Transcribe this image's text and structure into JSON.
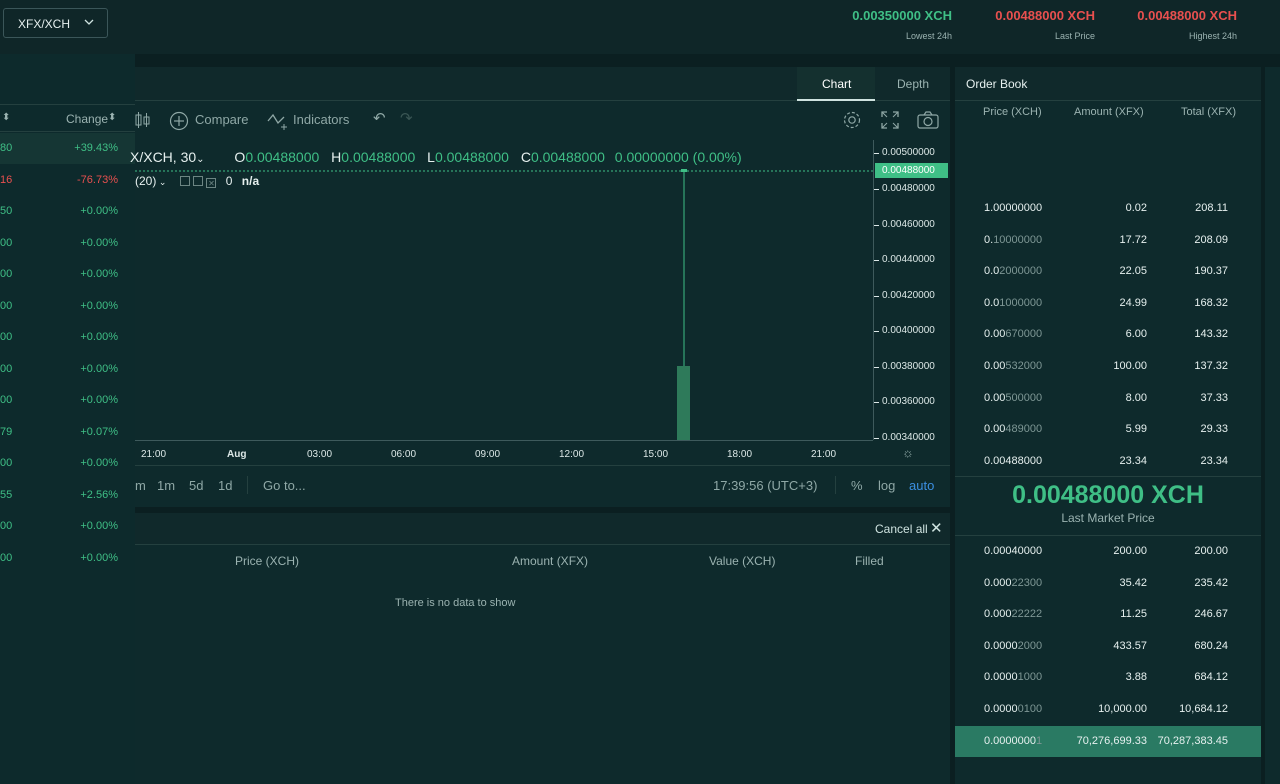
{
  "header": {
    "pair": "XFX/XCH",
    "stats": [
      {
        "value": "0.00350000 XCH",
        "label": "Lowest 24h",
        "color": "green"
      },
      {
        "value": "0.00488000 XCH",
        "label": "Last Price",
        "color": "red"
      },
      {
        "value": "0.00488000 XCH",
        "label": "Highest 24h",
        "color": "red"
      }
    ]
  },
  "markets": {
    "change_header": "Change",
    "rows": [
      {
        "price": "80",
        "change": "+39.43%",
        "color": "green"
      },
      {
        "price": "16",
        "change": "-76.73%",
        "color": "red"
      },
      {
        "price": "50",
        "change": "+0.00%",
        "color": "green"
      },
      {
        "price": "00",
        "change": "+0.00%",
        "color": "green"
      },
      {
        "price": "00",
        "change": "+0.00%",
        "color": "green"
      },
      {
        "price": "00",
        "change": "+0.00%",
        "color": "green"
      },
      {
        "price": "00",
        "change": "+0.00%",
        "color": "green"
      },
      {
        "price": "00",
        "change": "+0.00%",
        "color": "green"
      },
      {
        "price": "00",
        "change": "+0.00%",
        "color": "green"
      },
      {
        "price": "79",
        "change": "+0.07%",
        "color": "green"
      },
      {
        "price": "00",
        "change": "+0.00%",
        "color": "green"
      },
      {
        "price": "55",
        "change": "+2.56%",
        "color": "green"
      },
      {
        "price": "00",
        "change": "+0.00%",
        "color": "green"
      },
      {
        "price": "00",
        "change": "+0.00%",
        "color": "green"
      }
    ]
  },
  "chart": {
    "tabs": [
      "Chart",
      "Depth"
    ],
    "active_tab": "Chart",
    "toolbar": {
      "compare": "Compare",
      "indicators": "Indicators"
    },
    "symbol": "X/XCH, 30",
    "ohlc": {
      "o": "0.00488000",
      "h": "0.00488000",
      "l": "0.00488000",
      "c": "0.00488000",
      "chg": "0.00000000 (0.00%)"
    },
    "volume": {
      "label": "(20)",
      "value": "0",
      "extra": "n/a"
    },
    "price_ticks": [
      "0.00500000",
      "0.00480000",
      "0.00460000",
      "0.00440000",
      "0.00420000",
      "0.00400000",
      "0.00380000",
      "0.00360000",
      "0.00340000"
    ],
    "last_price_tag": "0.00488000",
    "time_ticks": [
      "21:00",
      "Aug",
      "03:00",
      "06:00",
      "09:00",
      "12:00",
      "15:00",
      "18:00",
      "21:00"
    ],
    "ranges": [
      "m",
      "1m",
      "5d",
      "1d"
    ],
    "goto": "Go to...",
    "clock": "17:39:56 (UTC+3)",
    "pct": "%",
    "log": "log",
    "auto": "auto"
  },
  "orders": {
    "cancel_all": "Cancel all",
    "columns": [
      "Price (XCH)",
      "Amount (XFX)",
      "Value (XCH)",
      "Filled"
    ],
    "empty": "There is no data to show"
  },
  "order_book": {
    "title": "Order Book",
    "columns": [
      "Price (XCH)",
      "Amount (XFX)",
      "Total (XFX)"
    ],
    "asks": [
      {
        "pb": "1.00000000",
        "pd": "",
        "amount": "0.02",
        "total": "208.11"
      },
      {
        "pb": "0.",
        "pd": "10000000",
        "amount": "17.72",
        "total": "208.09"
      },
      {
        "pb": "0.0",
        "pd": "2000000",
        "amount": "22.05",
        "total": "190.37"
      },
      {
        "pb": "0.0",
        "pd": "1000000",
        "amount": "24.99",
        "total": "168.32"
      },
      {
        "pb": "0.00",
        "pd": "670000",
        "amount": "6.00",
        "total": "143.32"
      },
      {
        "pb": "0.00",
        "pd": "532000",
        "amount": "100.00",
        "total": "137.32"
      },
      {
        "pb": "0.00",
        "pd": "500000",
        "amount": "8.00",
        "total": "37.33"
      },
      {
        "pb": "0.00",
        "pd": "489000",
        "amount": "5.99",
        "total": "29.33"
      },
      {
        "pb": "0.00488000",
        "pd": "",
        "amount": "23.34",
        "total": "23.34"
      }
    ],
    "last_price": "0.00488000 XCH",
    "last_price_label": "Last Market Price",
    "bids": [
      {
        "pb": "0.00040000",
        "pd": "",
        "amount": "200.00",
        "total": "200.00"
      },
      {
        "pb": "0.000",
        "pd": "22300",
        "amount": "35.42",
        "total": "235.42"
      },
      {
        "pb": "0.000",
        "pd": "22222",
        "amount": "11.25",
        "total": "246.67"
      },
      {
        "pb": "0.0000",
        "pd": "2000",
        "amount": "433.57",
        "total": "680.24"
      },
      {
        "pb": "0.0000",
        "pd": "1000",
        "amount": "3.88",
        "total": "684.12"
      },
      {
        "pb": "0.0000",
        "pd": "0100",
        "amount": "10,000.00",
        "total": "10,684.12"
      },
      {
        "pb": "0.0000000",
        "pd": "1",
        "amount": "70,276,699.33",
        "total": "70,287,383.45"
      }
    ]
  },
  "colors": {
    "green": "#3fbf86",
    "red": "#e8504f",
    "bg": "#0b1f21"
  }
}
